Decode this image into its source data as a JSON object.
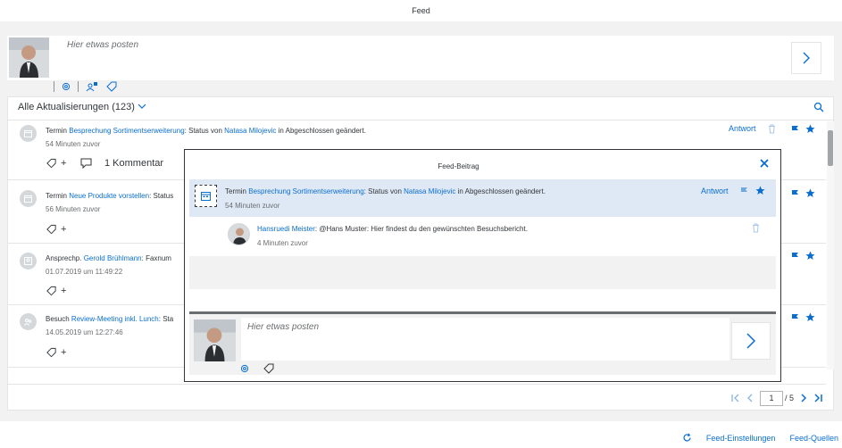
{
  "page": {
    "title": "Feed"
  },
  "composer": {
    "placeholder": "Hier etwas posten"
  },
  "feed": {
    "filter_label": "Alle Aktualisierungen",
    "count": "(123)",
    "items": [
      {
        "prefix": "Termin",
        "subject": "Besprechung Sortimentserweiterung",
        "mid": ": Status von",
        "person": "Natasa Milojevic",
        "suffix": "in Abgeschlossen geändert.",
        "time": "54 Minuten zuvor",
        "tag_plus": "+",
        "comment_label": "1 Kommentar",
        "reply_label": "Antwort"
      },
      {
        "prefix": "Termin",
        "subject": "Neue Produkte vorstellen",
        "mid": ": Status",
        "time": "56 Minuten zuvor",
        "tag_plus": "+"
      },
      {
        "prefix": "Ansprechp.",
        "subject": "Gerold Brühlmann",
        "mid": ": Faxnum",
        "time": "01.07.2019 um 11:49:22",
        "tag_plus": "+"
      },
      {
        "prefix": "Besuch",
        "subject": "Review-Meeting inkl. Lunch",
        "mid": ": Sta",
        "time": "14.05.2019 um 12:27:46",
        "tag_plus": "+"
      }
    ]
  },
  "pager": {
    "current": "1",
    "total": "/ 5"
  },
  "footer": {
    "settings_label": "Feed-Einstellungen",
    "sources_label": "Feed-Quellen"
  },
  "dialog": {
    "title": "Feed-Beitrag",
    "post": {
      "prefix": "Termin",
      "subject": "Besprechung Sortimentserweiterung",
      "mid": ": Status von",
      "person": "Natasa Milojevic",
      "suffix": "in Abgeschlossen geändert.",
      "time": "54 Minuten zuvor",
      "reply_label": "Antwort"
    },
    "comment": {
      "author": "Hansruedi Meister",
      "text": ": @Hans Muster: Hier findest du den gewünschten Besuchsbericht.",
      "time": "4 Minuten zuvor"
    },
    "composer_placeholder": "Hier etwas posten"
  },
  "colors": {
    "accent": "#0a6ed1",
    "text": "#32363a",
    "muted": "#6a6d70",
    "selected": "#dfe9f5"
  }
}
